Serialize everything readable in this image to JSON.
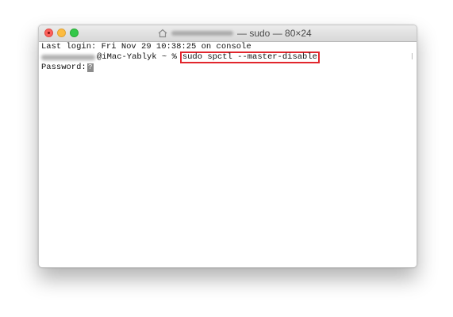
{
  "window": {
    "title_suffix": "— sudo — 80×24"
  },
  "icons": {
    "home": "house-icon",
    "close": "close-icon",
    "minimize": "minimize-icon",
    "maximize": "maximize-icon"
  },
  "terminal": {
    "last_login": "Last login: Fri Nov 29 10:38:25 on console",
    "prompt_host": "@iMac-Yablyk ~ %",
    "command": "sudo spctl --master-disable",
    "password_prompt": "Password:",
    "cursor_glyph": "?"
  },
  "colors": {
    "highlight_border": "#e1262d",
    "close": "#fc605b",
    "minimize": "#fdbc40",
    "maximize": "#34c84a"
  }
}
